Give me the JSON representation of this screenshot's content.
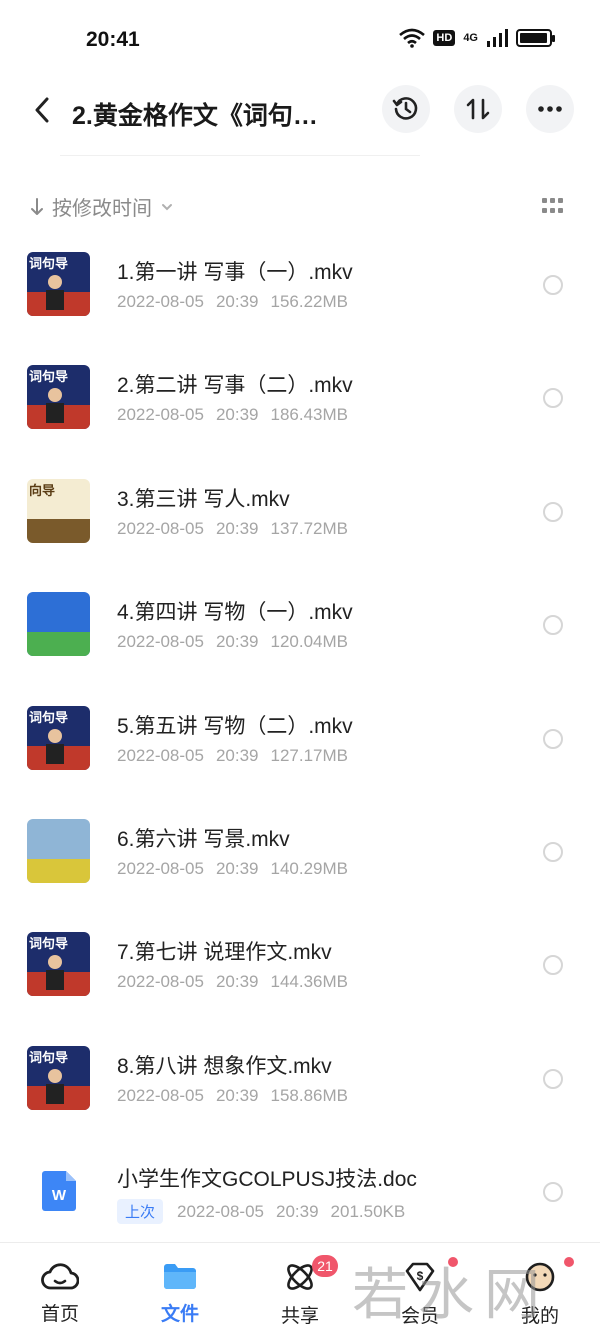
{
  "status_bar": {
    "time": "20:41",
    "hd_label": "HD",
    "network_label": "4G",
    "battery_level": 0.95
  },
  "header": {
    "title": "2.黄金格作文《词句…"
  },
  "sort": {
    "label": "按修改时间"
  },
  "files": [
    {
      "name": "1.第一讲 写事（一）.mkv",
      "date": "2022-08-05",
      "time": "20:39",
      "size": "156.22MB",
      "thumb_text": "词句导",
      "thumb_colors": [
        "#1d2d6b",
        "#c0392b"
      ]
    },
    {
      "name": "2.第二讲 写事（二）.mkv",
      "date": "2022-08-05",
      "time": "20:39",
      "size": "186.43MB",
      "thumb_text": "词句导",
      "thumb_colors": [
        "#1d2d6b",
        "#c0392b"
      ]
    },
    {
      "name": "3.第三讲 写人.mkv",
      "date": "2022-08-05",
      "time": "20:39",
      "size": "137.72MB",
      "thumb_text": "向导",
      "thumb_colors": [
        "#f4ecd2",
        "#7a5a2b"
      ]
    },
    {
      "name": "4.第四讲 写物（一）.mkv",
      "date": "2022-08-05",
      "time": "20:39",
      "size": "120.04MB",
      "thumb_text": "",
      "thumb_colors": [
        "#2d6fd6",
        "#4caf50"
      ]
    },
    {
      "name": "5.第五讲 写物（二）.mkv",
      "date": "2022-08-05",
      "time": "20:39",
      "size": "127.17MB",
      "thumb_text": "词句导",
      "thumb_colors": [
        "#1d2d6b",
        "#c0392b"
      ]
    },
    {
      "name": "6.第六讲 写景.mkv",
      "date": "2022-08-05",
      "time": "20:39",
      "size": "140.29MB",
      "thumb_text": "",
      "thumb_colors": [
        "#8fb5d6",
        "#d9c63a"
      ]
    },
    {
      "name": "7.第七讲 说理作文.mkv",
      "date": "2022-08-05",
      "time": "20:39",
      "size": "144.36MB",
      "thumb_text": "词句导",
      "thumb_colors": [
        "#1d2d6b",
        "#c0392b"
      ]
    },
    {
      "name": "8.第八讲 想象作文.mkv",
      "date": "2022-08-05",
      "time": "20:39",
      "size": "158.86MB",
      "thumb_text": "词句导",
      "thumb_colors": [
        "#1d2d6b",
        "#c0392b"
      ]
    }
  ],
  "doc_file": {
    "name": "小学生作文GCOLPUSJ技法.doc",
    "badge": "上次",
    "date": "2022-08-05",
    "time": "20:39",
    "size": "201.50KB",
    "icon_letter": "W"
  },
  "nav": [
    {
      "label": "首页",
      "icon": "cloud-icon"
    },
    {
      "label": "文件",
      "icon": "folder-icon"
    },
    {
      "label": "共享",
      "icon": "atom-icon",
      "badge": "21"
    },
    {
      "label": "会员",
      "icon": "vip-icon"
    },
    {
      "label": "我的",
      "icon": "profile-icon"
    }
  ],
  "watermark": "若水网",
  "colors": {
    "accent": "#3a7cf5",
    "badge": "#f0566b"
  }
}
